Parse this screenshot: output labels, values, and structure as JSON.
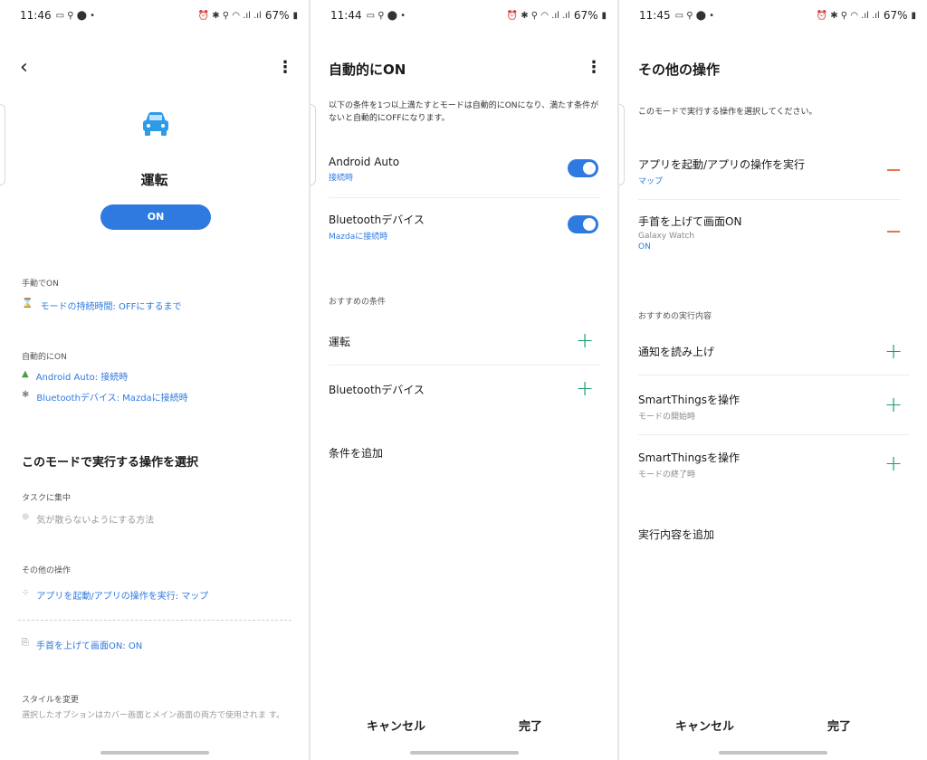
{
  "screen1": {
    "status": {
      "time": "11:46",
      "battery": "67%"
    },
    "mode_name": "運転",
    "on_button": "ON",
    "manual_section": "手動でON",
    "manual_item": "モードの持続時間: OFFにするまで",
    "auto_section": "自動的にON",
    "auto_items": [
      "Android Auto: 接続時",
      "Bluetoothデバイス: Mazdaに接続時"
    ],
    "actions_heading": "このモードで実行する操作を選択",
    "focus_section": "タスクに集中",
    "focus_item": "気が散らないようにする方法",
    "other_section": "その他の操作",
    "other_items": [
      "アプリを起動/アプリの操作を実行: マップ",
      "手首を上げて画面ON: ON"
    ],
    "style_section": "スタイルを変更",
    "style_desc": "選択したオプションはカバー画面とメイン画面の両方で使用されま す。"
  },
  "screen2": {
    "status": {
      "time": "11:44",
      "battery": "67%"
    },
    "title": "自動的にON",
    "description": "以下の条件を1つ以上満たすとモードは自動的にONになり、満たす条件がないと自動的にOFFになります。",
    "conditions": [
      {
        "title": "Android Auto",
        "sub": "接続時"
      },
      {
        "title": "Bluetoothデバイス",
        "sub": "Mazdaに接続時"
      }
    ],
    "recommended_section": "おすすめの条件",
    "recommended": [
      "運転",
      "Bluetoothデバイス"
    ],
    "add_condition": "条件を追加",
    "cancel": "キャンセル",
    "done": "完了"
  },
  "screen3": {
    "status": {
      "time": "11:45",
      "battery": "67%"
    },
    "title": "その他の操作",
    "description": "このモードで実行する操作を選択してください。",
    "actions": [
      {
        "title": "アプリを起動/アプリの操作を実行",
        "sub": "マップ"
      },
      {
        "title": "手首を上げて画面ON",
        "sub1": "Galaxy Watch",
        "sub2": "ON"
      }
    ],
    "recommended_section": "おすすめの実行内容",
    "recommended": [
      {
        "title": "通知を読み上げ",
        "sub": ""
      },
      {
        "title": "SmartThingsを操作",
        "sub": "モードの開始時"
      },
      {
        "title": "SmartThingsを操作",
        "sub": "モードの終了時"
      }
    ],
    "add_action": "実行内容を追加",
    "cancel": "キャンセル",
    "done": "完了"
  },
  "colors": {
    "accent": "#2e7ae0",
    "plus": "#1a9e6a",
    "minus": "#e8734a"
  },
  "icons": [
    "back-icon",
    "more-icon",
    "car-icon",
    "hourglass-icon",
    "android-auto-icon",
    "bluetooth-icon",
    "plus-circle-icon",
    "apps-icon",
    "wrist-icon",
    "plus-icon",
    "minus-icon"
  ]
}
